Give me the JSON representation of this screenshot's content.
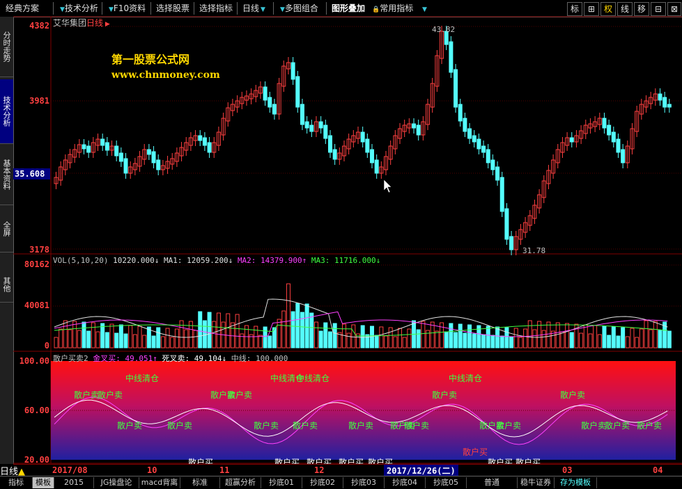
{
  "menu": [
    {
      "label": "经典方案",
      "arrow": false
    },
    {
      "label": "技术分析",
      "arrow": true
    },
    {
      "label": "F10资料",
      "arrow": true
    },
    {
      "label": "选择股票",
      "arrow": false
    },
    {
      "label": "选择指标",
      "arrow": false
    },
    {
      "label": "日线",
      "arrow": true
    },
    {
      "label": "多图组合",
      "arrow": true
    },
    {
      "label": "图形叠加",
      "arrow": false
    },
    {
      "label": "常用指标",
      "arrow": true
    }
  ],
  "toolbar_right": [
    "标",
    "⊞",
    "权",
    "线",
    "移",
    "⊟",
    "⊠"
  ],
  "sidebar": [
    "分时走势",
    "技术分析",
    "基本资料",
    "全屏",
    "其他"
  ],
  "stock": {
    "name": "艾华集团",
    "period": "日线"
  },
  "watermark": {
    "line1": "第一股票公式网",
    "line2": "www.chnmoney.com"
  },
  "price_axis": {
    "top": "4382",
    "mid": "3981",
    "current": "35.608",
    "bottom": "3178"
  },
  "price_annotations": {
    "high": "43.82",
    "low": "31.78"
  },
  "vol": {
    "title": "VOL(5,10,20)",
    "value": "10220.000↓",
    "ma1": "MA1: 12059.200↓",
    "ma2": "MA2: 14379.900↑",
    "ma3": "MA3: 11716.000↓",
    "axis_top": "80162",
    "axis_mid": "40081",
    "axis_bottom": "0"
  },
  "osc": {
    "title": "散户买卖2",
    "gold": "金叉买: 49.051↑",
    "dead": "死叉卖: 49.104↓",
    "mid": "中线: 100.000",
    "axis_top": "100.00",
    "axis_mid": "60.00",
    "axis_bottom": "20.00",
    "labels_clear": [
      "中线清仓",
      "中线清仓",
      "中线清仓",
      "中线清仓"
    ],
    "labels_sell": [
      "散户卖",
      "散户卖",
      "散户卖",
      "散户卖",
      "散户卖",
      "散户卖",
      "散户卖",
      "散户卖",
      "散户卖",
      "散户卖",
      "散户卖",
      "散户卖",
      "散户卖",
      "散户卖",
      "散户卖",
      "散户卖",
      "散户卖",
      "散户卖"
    ],
    "labels_buy": [
      "散户买",
      "散户买",
      "散户买",
      "散户买",
      "散户买",
      "散户买",
      "散户买",
      "散户买"
    ]
  },
  "dates": {
    "left": "2017/08",
    "d10": "10",
    "d11": "11",
    "d12": "12",
    "cursor": "2017/12/26(二)",
    "d03": "03",
    "d04": "04"
  },
  "bottom_tabs": [
    "指标",
    "模板",
    "2015",
    "JG操盘论",
    "macd背离",
    "标准",
    "超赢分析",
    "抄底01",
    "抄底02",
    "抄底03",
    "抄底04",
    "抄底05",
    "普通",
    "稳牛证券",
    "存为模板"
  ],
  "period_label": "日线",
  "colors": {
    "up": "#ff4040",
    "down": "#54ffff",
    "ma2": "#ff40ff",
    "ma3": "#40ff40",
    "label": "#40ff40"
  }
}
